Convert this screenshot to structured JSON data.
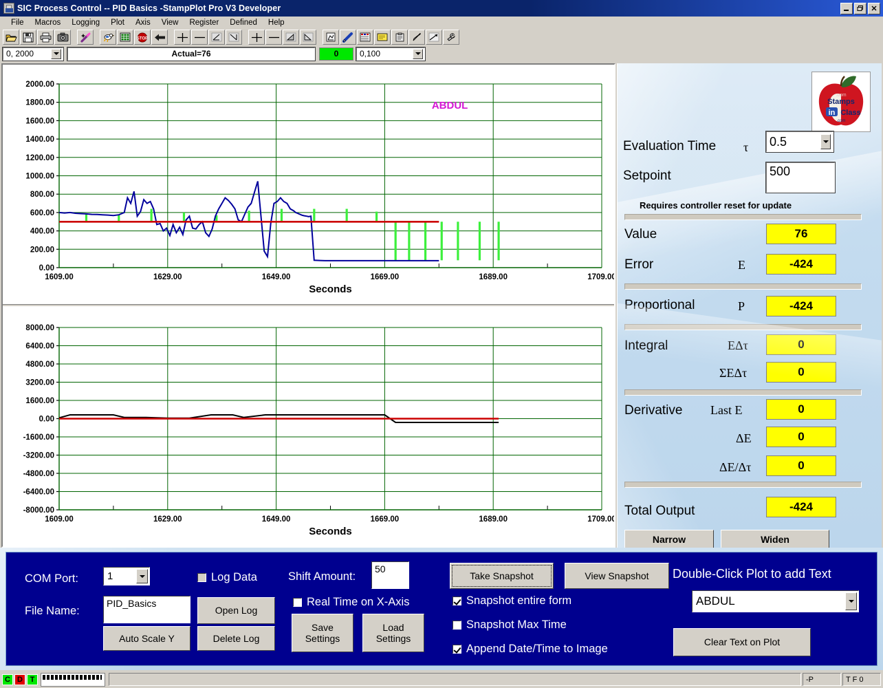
{
  "window": {
    "title": "SIC Process Control -- PID Basics -StampPlot Pro V3 Developer",
    "minimize_label": "_",
    "restore_label": "❐",
    "close_label": "✕"
  },
  "menu": {
    "items": [
      "File",
      "Macros",
      "Logging",
      "Plot",
      "Axis",
      "View",
      "Register",
      "Defined",
      "Help"
    ]
  },
  "toolbar": {
    "icons": [
      "open-folder-icon",
      "save-disk-icon",
      "print-icon",
      "camera-icon",
      "magic-wand-icon",
      "run-bird-icon",
      "grid-icon",
      "stop-icon",
      "back-arrow-icon",
      "add-crosshair-icon",
      "remove-line-icon",
      "slope-up-icon",
      "slope-down-icon",
      "add-crosshair2-icon",
      "remove-line2-icon",
      "fill-left-icon",
      "fill-right-icon",
      "export-plot-icon",
      "pen-icon",
      "data-table-icon",
      "notes-icon",
      "clipboard-icon",
      "pointer-icon",
      "trend-icon",
      "wrench-icon"
    ],
    "zoom_combo_value": "0, 2000",
    "actual_field_value": "Actual=76",
    "status_indicator_value": "0",
    "rate_combo_value": "0,100"
  },
  "chart_data": [
    {
      "type": "line",
      "id": "top-chart",
      "title": "",
      "xlabel": "Seconds",
      "ylabel": "",
      "xlim": [
        1609,
        1709
      ],
      "ylim": [
        0,
        2000
      ],
      "xticks": [
        "1609.00",
        "1629.00",
        "1649.00",
        "1669.00",
        "1689.00",
        "1709.00"
      ],
      "yticks": [
        "0.00",
        "200.00",
        "400.00",
        "600.00",
        "800.00",
        "1000.00",
        "1200.00",
        "1400.00",
        "1600.00",
        "1800.00",
        "2000.00"
      ],
      "grid": true,
      "annotations": [
        {
          "text": "ABDUL",
          "x": 1681,
          "y": 1730,
          "color": "#d417d4"
        }
      ],
      "series": [
        {
          "name": "Value",
          "color": "#00009c",
          "x": [
            1609.0,
            1610.0,
            1611.0,
            1612.0,
            1613.0,
            1614.0,
            1615.0,
            1616.0,
            1617.0,
            1618.0,
            1619.0,
            1620.0,
            1621.0,
            1621.6,
            1622.2,
            1622.8,
            1623.4,
            1624.0,
            1624.6,
            1625.2,
            1625.8,
            1626.4,
            1627.0,
            1627.6,
            1628.2,
            1628.8,
            1629.4,
            1630.0,
            1630.6,
            1631.2,
            1631.8,
            1632.4,
            1633.0,
            1633.6,
            1634.2,
            1634.8,
            1635.4,
            1636.0,
            1636.6,
            1637.2,
            1637.8,
            1638.4,
            1639.0,
            1639.6,
            1640.2,
            1640.8,
            1641.4,
            1642.0,
            1642.6,
            1643.2,
            1643.8,
            1644.4,
            1645.0,
            1645.6,
            1646.2,
            1646.8,
            1647.4,
            1648.0,
            1648.6,
            1649.2,
            1649.8,
            1650.4,
            1651.0,
            1651.6,
            1652.2,
            1652.6,
            1653.0,
            1653.4,
            1653.8,
            1654.2,
            1654.6,
            1655.0,
            1655.4,
            1656.0,
            1657.0,
            1658.0,
            1659.0,
            1660.0,
            1661.0,
            1662.0,
            1663.0,
            1664.0,
            1665.0,
            1666.0,
            1666.4,
            1666.8,
            1667.2,
            1667.6,
            1668.0,
            1679.0
          ],
          "y": [
            600,
            595,
            600,
            592,
            588,
            585,
            580,
            578,
            575,
            572,
            568,
            575,
            600,
            760,
            700,
            830,
            560,
            610,
            740,
            700,
            720,
            640,
            470,
            480,
            400,
            430,
            350,
            470,
            380,
            440,
            360,
            520,
            560,
            430,
            420,
            470,
            500,
            380,
            340,
            420,
            560,
            640,
            700,
            760,
            730,
            690,
            640,
            520,
            500,
            580,
            660,
            700,
            820,
            940,
            560,
            180,
            120,
            480,
            700,
            720,
            760,
            720,
            700,
            640,
            620,
            600,
            590,
            580,
            570,
            565,
            560,
            555,
            560,
            80,
            78,
            76,
            76,
            76,
            76,
            76,
            76,
            76,
            76,
            76,
            76,
            76,
            76,
            76,
            76,
            76
          ]
        },
        {
          "name": "Setpoint",
          "color": "#cc0000",
          "x": [
            1609,
            1679
          ],
          "y": [
            500,
            500
          ]
        }
      ],
      "bars": {
        "name": "Output",
        "color": "#3cf03c",
        "items": [
          {
            "x": 1614.0,
            "y0": 500,
            "y1": 580
          },
          {
            "x": 1620.0,
            "y0": 500,
            "y1": 580
          },
          {
            "x": 1626.0,
            "y0": 500,
            "y1": 640
          },
          {
            "x": 1632.0,
            "y0": 500,
            "y1": 600
          },
          {
            "x": 1638.0,
            "y0": 500,
            "y1": 570
          },
          {
            "x": 1644.0,
            "y0": 500,
            "y1": 620
          },
          {
            "x": 1650.0,
            "y0": 500,
            "y1": 640
          },
          {
            "x": 1656.0,
            "y0": 500,
            "y1": 640
          },
          {
            "x": 1662.0,
            "y0": 500,
            "y1": 640
          },
          {
            "x": 1667.5,
            "y0": 500,
            "y1": 610
          },
          {
            "x": 1671.0,
            "y0": 500,
            "y1": 80
          },
          {
            "x": 1673.5,
            "y0": 500,
            "y1": 80
          },
          {
            "x": 1676.5,
            "y0": 500,
            "y1": 80
          },
          {
            "x": 1679.5,
            "y0": 500,
            "y1": 80
          },
          {
            "x": 1682.5,
            "y0": 500,
            "y1": 80
          },
          {
            "x": 1686.5,
            "y0": 500,
            "y1": 80
          },
          {
            "x": 1690.0,
            "y0": 500,
            "y1": 80
          }
        ]
      }
    },
    {
      "type": "line",
      "id": "bottom-chart",
      "title": "",
      "xlabel": "Seconds",
      "ylabel": "",
      "xlim": [
        1609,
        1709
      ],
      "ylim": [
        -8000,
        8000
      ],
      "xticks": [
        "1609.00",
        "1629.00",
        "1649.00",
        "1669.00",
        "1689.00",
        "1709.00"
      ],
      "yticks": [
        "-8000.00",
        "-6400.00",
        "-4800.00",
        "-3200.00",
        "-1600.00",
        "0.00",
        "1600.00",
        "3200.00",
        "4800.00",
        "6400.00",
        "8000.00"
      ],
      "grid": true,
      "series": [
        {
          "name": "Integral",
          "color": "#000000",
          "x": [
            1609,
            1611,
            1615,
            1619,
            1621,
            1625,
            1629,
            1633,
            1637,
            1641,
            1643,
            1647,
            1651,
            1655,
            1659,
            1663,
            1667,
            1669,
            1671,
            1690
          ],
          "y": [
            70,
            330,
            330,
            330,
            110,
            110,
            40,
            40,
            330,
            330,
            110,
            330,
            330,
            330,
            330,
            330,
            330,
            330,
            -330,
            -330
          ]
        },
        {
          "name": "Derivative",
          "color": "#cc0000",
          "x": [
            1609,
            1690
          ],
          "y": [
            0,
            0
          ]
        }
      ]
    }
  ],
  "pid_panel": {
    "logo_alt": "Stamps in Class",
    "evaluation_time_label": "Evaluation Time",
    "evaluation_time_symbol": "τ",
    "evaluation_time_value": "0.5",
    "setpoint_label": "Setpoint",
    "setpoint_value": "500",
    "reset_note": "Requires controller reset for update",
    "value_label": "Value",
    "value_value": "76",
    "error_label": "Error",
    "error_symbol": "E",
    "error_value": "-424",
    "proportional_label": "Proportional",
    "proportional_symbol": "P",
    "proportional_value": "-424",
    "integral_label": "Integral",
    "integral_symbol_1": "EΔτ",
    "integral_value_1": "0",
    "integral_symbol_2": "ΣEΔτ",
    "integral_value_2": "0",
    "derivative_label": "Derivative",
    "derivative_symbol_1": "Last E",
    "derivative_value_1": "0",
    "derivative_symbol_2": "ΔE",
    "derivative_value_2": "0",
    "derivative_symbol_3": "ΔE/Δτ",
    "derivative_value_3": "0",
    "total_output_label": "Total Output",
    "total_output_value": "-424",
    "narrow_button": "Narrow",
    "widen_button": "Widen"
  },
  "bottom_panel": {
    "com_port_label": "COM Port:",
    "com_port_value": "1",
    "file_name_label": "File Name:",
    "file_name_value": "PID_Basics",
    "auto_scale_button": "Auto Scale Y",
    "log_data_label": "Log Data",
    "log_data_checked": false,
    "open_log_button": "Open Log",
    "delete_log_button": "Delete Log",
    "shift_amount_label": "Shift Amount:",
    "shift_amount_value": "50",
    "real_time_label": "Real Time on X-Axis",
    "real_time_checked": false,
    "save_settings_button": "Save\nSettings",
    "save_settings_line1": "Save",
    "save_settings_line2": "Settings",
    "load_settings_line1": "Load",
    "load_settings_line2": "Settings",
    "take_snapshot_button": "Take Snapshot",
    "view_snapshot_button": "View Snapshot",
    "snapshot_form_label": "Snapshot entire form",
    "snapshot_form_checked": true,
    "snapshot_max_label": "Snapshot Max Time",
    "snapshot_max_checked": false,
    "append_date_label": "Append Date/Time to Image",
    "append_date_checked": true,
    "double_click_label": "Double-Click Plot to add Text",
    "text_combo_value": "ABDUL",
    "clear_text_button": "Clear Text on Plot"
  },
  "statusbar": {
    "led_c": "C",
    "led_d": "D",
    "led_t": "T",
    "led_c_color": "#00e800",
    "led_d_color": "#e00000",
    "led_t_color": "#00e800",
    "main_text": "",
    "pane_p": "-P",
    "pane_tf": "T F 0"
  },
  "colors": {
    "titlebar": "#0a246a",
    "panel_blue": "#00008f",
    "value_yellow": "#ffff00",
    "grid_green": "#006400",
    "trace_blue": "#00009c",
    "trace_red": "#cc0000",
    "bar_green": "#3cf03c",
    "annotation_magenta": "#d417d4"
  }
}
